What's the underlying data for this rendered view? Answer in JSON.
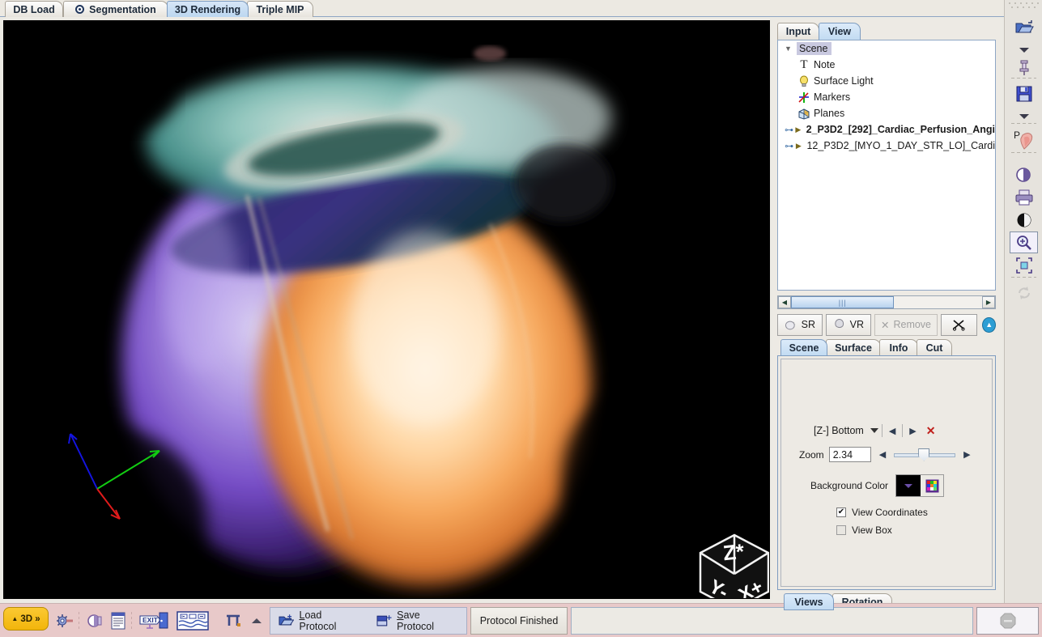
{
  "top_tabs": [
    {
      "label": "DB Load",
      "icon": "",
      "selected": false
    },
    {
      "label": "Segmentation",
      "icon": "segmentation-icon",
      "selected": false
    },
    {
      "label": "3D Rendering",
      "icon": "",
      "selected": true
    },
    {
      "label": "Triple MIP",
      "icon": "",
      "selected": false
    }
  ],
  "panel": {
    "tabs": [
      {
        "label": "Input",
        "selected": false
      },
      {
        "label": "View",
        "selected": true
      }
    ],
    "tree": [
      {
        "label": "Scene",
        "icon": "expand-arrow-icon",
        "selected": true,
        "bold": false,
        "depth": 0
      },
      {
        "label": "Note",
        "icon": "text-note-icon",
        "selected": false,
        "bold": false,
        "depth": 1
      },
      {
        "label": "Surface Light",
        "icon": "lightbulb-icon",
        "selected": false,
        "bold": false,
        "depth": 1
      },
      {
        "label": "Markers",
        "icon": "markers-axes-icon",
        "selected": false,
        "bold": false,
        "depth": 1
      },
      {
        "label": "Planes",
        "icon": "planes-cube-icon",
        "selected": false,
        "bold": false,
        "depth": 1
      },
      {
        "label": "2_P3D2_[292]_Cardiac_Perfusion_Angi",
        "icon": "collapsed-node-icon",
        "selected": false,
        "bold": true,
        "depth": 1
      },
      {
        "label": "12_P3D2_[MYO_1_DAY_STR_LO]_Cardi",
        "icon": "collapsed-node-icon",
        "selected": false,
        "bold": false,
        "depth": 1
      }
    ],
    "buttons": {
      "sr": "SR",
      "vr": "VR",
      "remove": "Remove",
      "cut_icon": "scissors-icon",
      "collapse_icon": "collapse-up-icon"
    },
    "sub_tabs": [
      {
        "label": "Scene",
        "selected": true
      },
      {
        "label": "Surface",
        "selected": false
      },
      {
        "label": "Info",
        "selected": false
      },
      {
        "label": "Cut",
        "selected": false
      }
    ],
    "scene": {
      "orientation_value": "[Z-] Bottom",
      "zoom_label": "Zoom",
      "zoom_value": "2.34",
      "background_color_label": "Background Color",
      "background_color_hex": "#000000",
      "view_coordinates_label": "View Coordinates",
      "view_coordinates_checked": true,
      "view_box_label": "View Box",
      "view_box_checked": false
    },
    "bottom_tabs": [
      {
        "label": "Views",
        "selected": true
      },
      {
        "label": "Rotation",
        "selected": false
      }
    ]
  },
  "viewport": {
    "orientation_cube": {
      "top_face": "Z*",
      "left_face": "Y-",
      "right_face": "X+"
    },
    "axes": {
      "x_color": "#e01b1b",
      "y_color": "#12cc12",
      "z_color": "#1414e0"
    }
  },
  "vertical_toolbar": [
    {
      "icon": "open-folder-icon",
      "selected": false,
      "disabled": false
    },
    {
      "icon": "chevron-down-icon",
      "selected": false,
      "disabled": false
    },
    {
      "icon": "pin-icon",
      "selected": false,
      "disabled": false
    },
    {
      "icon": "save-floppy-icon",
      "selected": false,
      "disabled": false
    },
    {
      "icon": "chevron-down-icon",
      "selected": false,
      "disabled": false
    },
    {
      "icon": "heart-protocol-icon",
      "selected": false,
      "disabled": false
    },
    {
      "icon": "contrast-circle-icon",
      "selected": false,
      "disabled": false
    },
    {
      "icon": "printer-icon",
      "selected": false,
      "disabled": false
    },
    {
      "icon": "window-level-icon",
      "selected": false,
      "disabled": false
    },
    {
      "icon": "zoom-magnifier-icon",
      "selected": true,
      "disabled": false
    },
    {
      "icon": "fit-to-screen-icon",
      "selected": false,
      "disabled": false
    },
    {
      "icon": "refresh-icon",
      "selected": false,
      "disabled": true
    }
  ],
  "bottom_bar": {
    "mode_button": "3D »",
    "icons": [
      "tools-wrench-icon",
      "contrast-icon",
      "film-sheet-icon",
      "exit-door-icon",
      "layout-film-icon",
      "measure-icon",
      "scroll-up-icon"
    ],
    "load_protocol": "Load Protocol",
    "load_protocol_mnemonic": "L",
    "save_protocol": "Save Protocol",
    "save_protocol_mnemonic": "S",
    "protocol_finished": "Protocol Finished",
    "corner_icon": "disabled-stop-icon"
  }
}
